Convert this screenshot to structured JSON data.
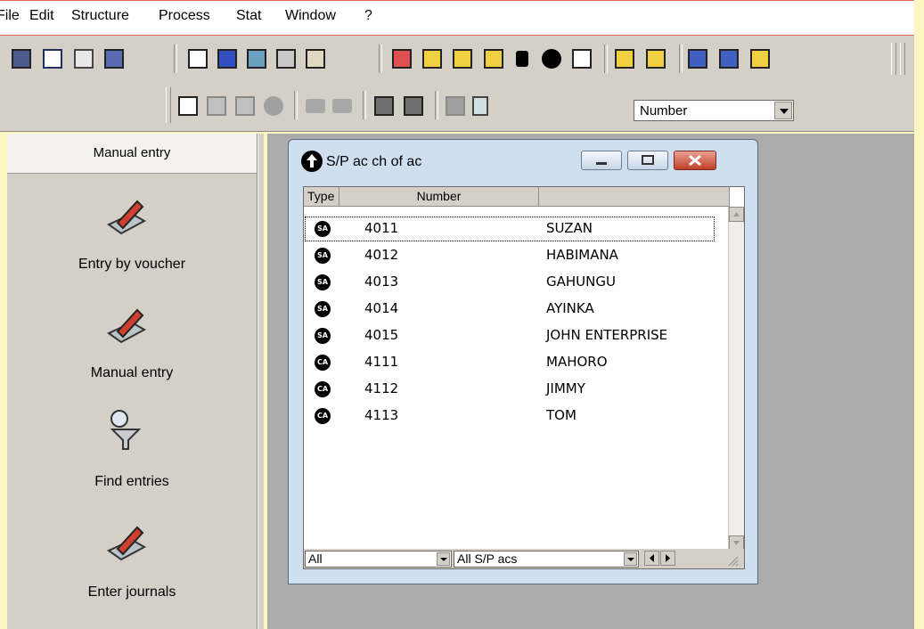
{
  "menu": [
    "File",
    "Edit",
    "Structure",
    "Process",
    "Stat",
    "Window",
    "?"
  ],
  "toolbar": {
    "row1_icons": [
      "calc-icon",
      "edit-sheet-icon",
      "search-sheet-icon",
      "calendar-icon",
      "doc-icon",
      "percent-icon",
      "account-icon",
      "bank-icon",
      "book-icon",
      "chart-icon",
      "stamp-icon",
      "stamp-search-icon",
      "stamp-edit-icon",
      "lock-icon",
      "pacman-icon",
      "list-icon",
      "doc-export-icon",
      "doc-import-icon",
      "building-icon",
      "bank-building-icon",
      "bank-book-icon"
    ],
    "row2_icons": [
      "add-doc-icon",
      "copy-doc-icon",
      "transfer-icon",
      "globe-icon",
      "back-arrow-icon",
      "forward-arrow-icon",
      "users-icon",
      "user-search-icon",
      "grid-icon",
      "calculator-icon"
    ],
    "sort_select": "Number"
  },
  "left_panel": {
    "header": "Manual entry",
    "items": [
      {
        "label": "Entry by voucher",
        "icon": "pencil-book-icon"
      },
      {
        "label": "Manual entry",
        "icon": "pencil-book-icon"
      },
      {
        "label": "Find entries",
        "icon": "search-funnel-icon"
      },
      {
        "label": "Enter journals",
        "icon": "pencil-book-icon"
      }
    ]
  },
  "window": {
    "title": "S/P ac ch of ac",
    "columns": [
      "Type",
      "Number",
      ""
    ],
    "rows": [
      {
        "type": "SA",
        "number": "4011",
        "name": "SUZAN"
      },
      {
        "type": "SA",
        "number": "4012",
        "name": "HABIMANA"
      },
      {
        "type": "SA",
        "number": "4013",
        "name": "GAHUNGU"
      },
      {
        "type": "SA",
        "number": "4014",
        "name": "AYINKA"
      },
      {
        "type": "SA",
        "number": "4015",
        "name": "JOHN ENTERPRISE"
      },
      {
        "type": "CA",
        "number": "4111",
        "name": "MAHORO"
      },
      {
        "type": "CA",
        "number": "4112",
        "name": "JIMMY"
      },
      {
        "type": "CA",
        "number": "4113",
        "name": "TOM"
      }
    ],
    "filter1": "All",
    "filter2": "All S/P acs"
  }
}
